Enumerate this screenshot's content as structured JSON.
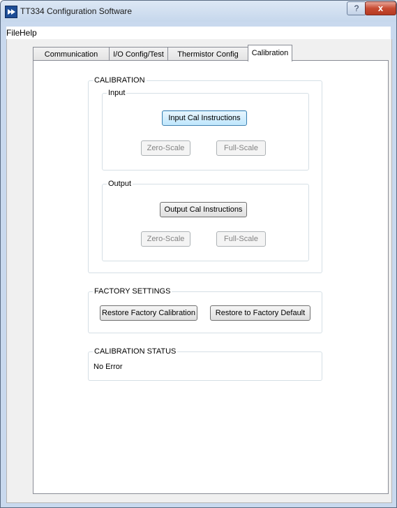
{
  "window": {
    "title": "TT334 Configuration Software"
  },
  "titlebar": {
    "help_icon": "?",
    "close_icon": "x"
  },
  "menu": {
    "file": "File",
    "help": "Help"
  },
  "tabs": [
    {
      "label": "Communication Setup"
    },
    {
      "label": "I/O Config/Test"
    },
    {
      "label": "Thermistor Config Table"
    },
    {
      "label": "Calibration"
    }
  ],
  "calibration": {
    "label": "CALIBRATION",
    "input": {
      "label": "Input",
      "instructions_button": "Input Cal Instructions",
      "zero_scale": "Zero-Scale",
      "full_scale": "Full-Scale"
    },
    "output": {
      "label": "Output",
      "instructions_button": "Output Cal Instructions",
      "zero_scale": "Zero-Scale",
      "full_scale": "Full-Scale"
    }
  },
  "factory_settings": {
    "label": "FACTORY SETTINGS",
    "restore_calibration": "Restore Factory Calibration",
    "restore_default": "Restore to Factory Default"
  },
  "calibration_status": {
    "label": "CALIBRATION STATUS",
    "value": "No Error"
  }
}
